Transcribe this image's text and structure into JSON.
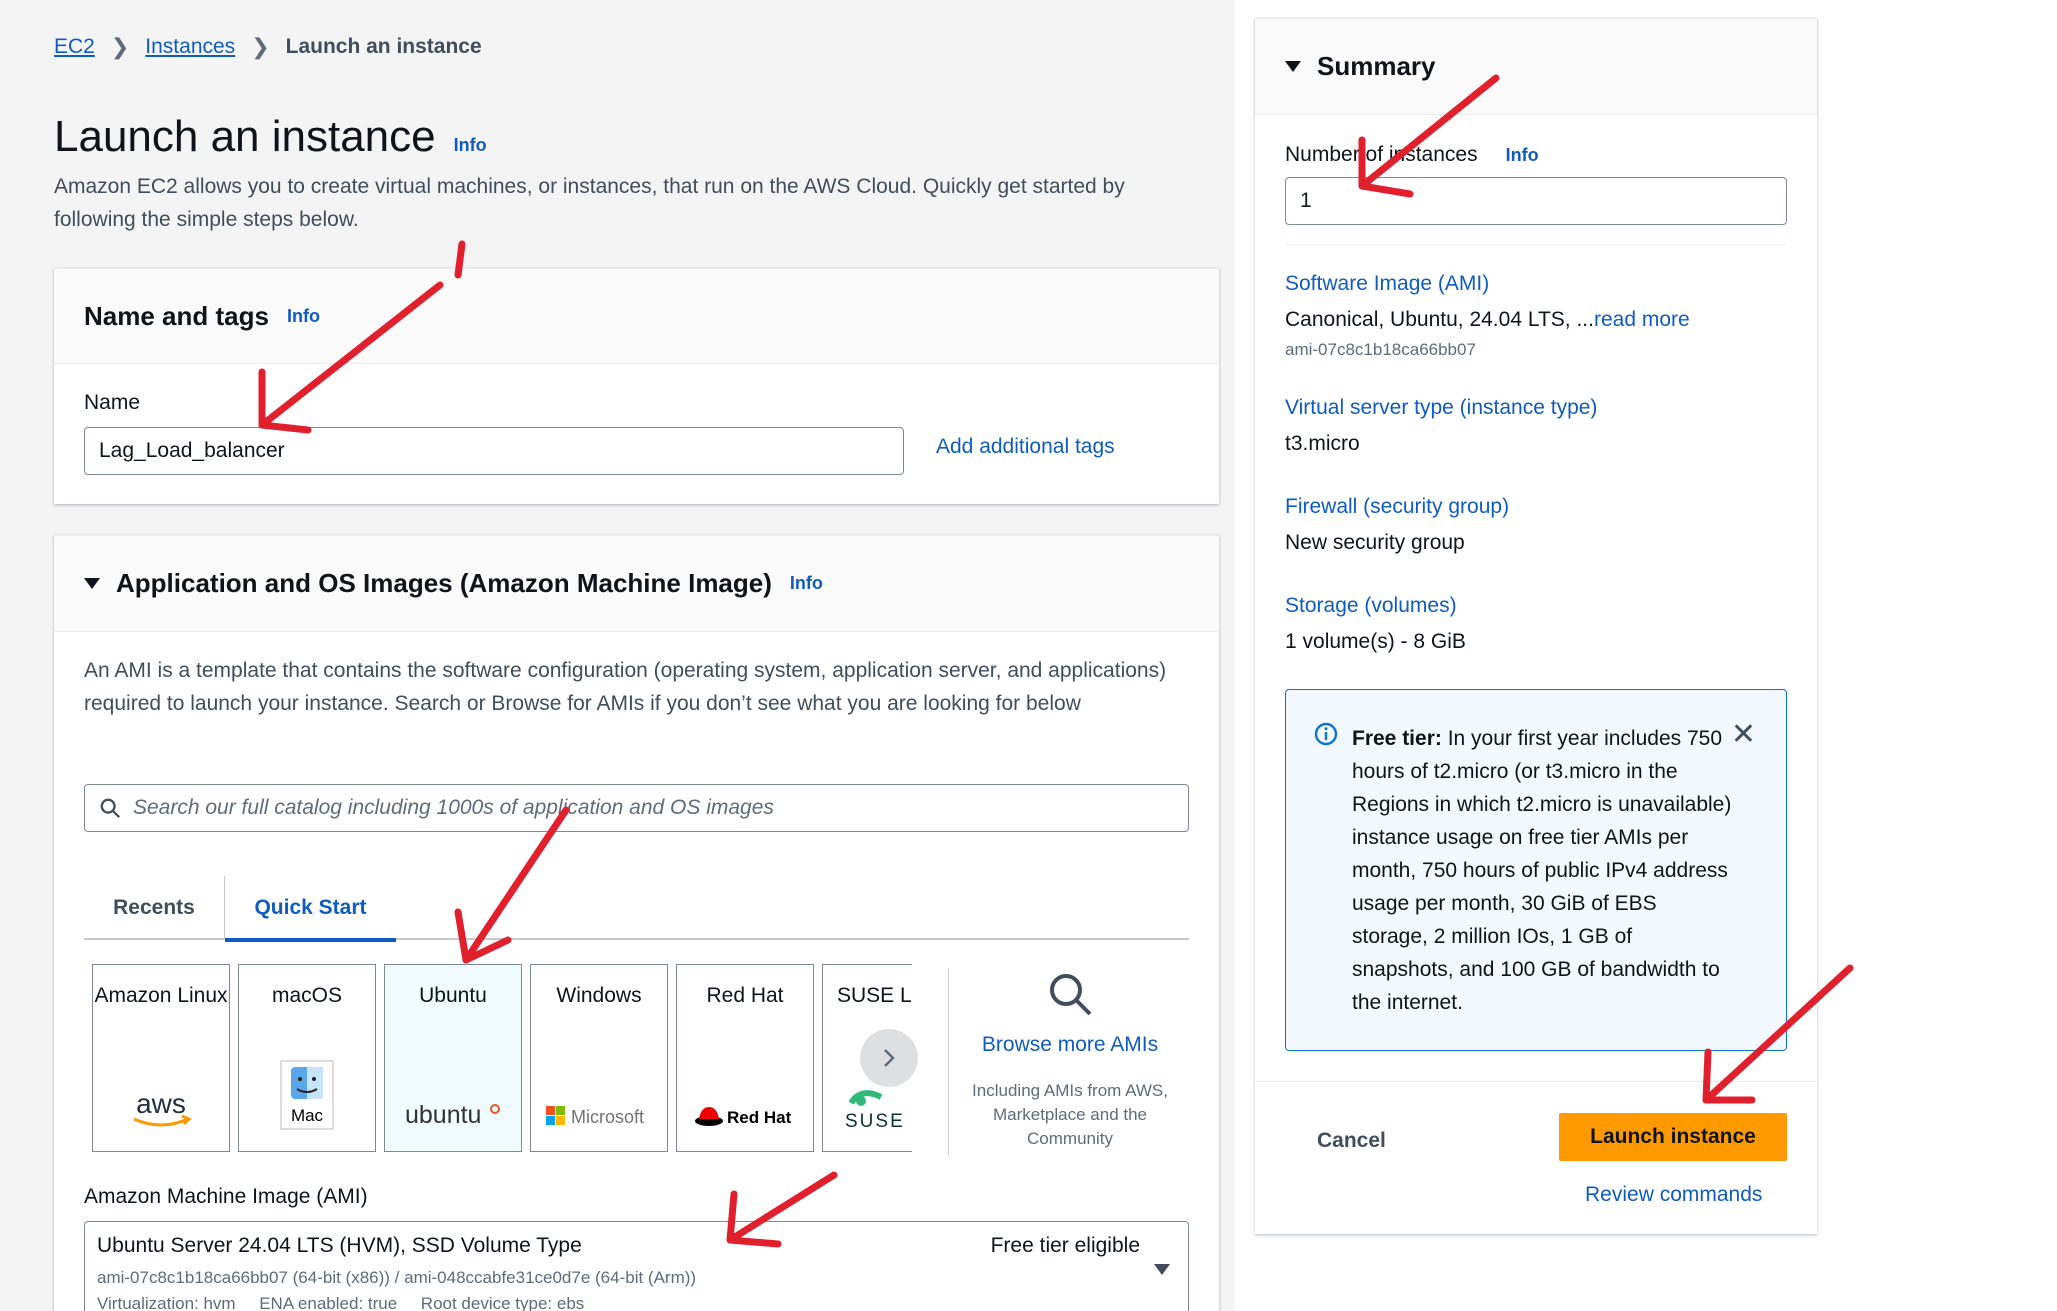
{
  "breadcrumb": {
    "ec2": "EC2",
    "instances": "Instances",
    "current": "Launch an instance"
  },
  "page": {
    "title": "Launch an instance",
    "info": "Info",
    "description": "Amazon EC2 allows you to create virtual machines, or instances, that run on the AWS Cloud. Quickly get started by following the simple steps below."
  },
  "name_tags": {
    "title": "Name and tags",
    "info": "Info",
    "name_label": "Name",
    "name_value": "Lag_Load_balancer",
    "add_tags": "Add additional tags"
  },
  "ami_section": {
    "title": "Application and OS Images (Amazon Machine Image)",
    "info": "Info",
    "description": "An AMI is a template that contains the software configuration (operating system, application server, and applications) required to launch your instance. Search or Browse for AMIs if you don’t see what you are looking for below",
    "search_placeholder": "Search our full catalog including 1000s of application and OS images",
    "tabs": [
      "Recents",
      "Quick Start"
    ],
    "active_tab": "Quick Start",
    "tiles": [
      {
        "label": "Amazon Linux",
        "logo_text": "aws"
      },
      {
        "label": "macOS",
        "logo_text": "Mac"
      },
      {
        "label": "Ubuntu",
        "logo_text": "ubuntu",
        "selected": true
      },
      {
        "label": "Windows",
        "logo_text": "Microsoft"
      },
      {
        "label": "Red Hat",
        "logo_text": "Red Hat"
      },
      {
        "label": "SUSE Li",
        "logo_text": "SUSE"
      }
    ],
    "browse_link": "Browse more AMIs",
    "browse_sub": "Including AMIs from AWS, Marketplace and the Community",
    "ami_label": "Amazon Machine Image (AMI)",
    "ami_name": "Ubuntu Server 24.04 LTS (HVM), SSD Volume Type",
    "ami_free": "Free tier eligible",
    "ami_ids": "ami-07c8c1b18ca66bb07 (64-bit (x86)) / ami-048ccabfe31ce0d7e (64-bit (Arm))",
    "ami_meta": "Virtualization: hvm     ENA enabled: true     Root device type: ebs"
  },
  "summary": {
    "title": "Summary",
    "num_label": "Number of instances",
    "info": "Info",
    "num_value": "1",
    "software_key": "Software Image (AMI)",
    "software_val": "Canonical, Ubuntu, 24.04 LTS, ...",
    "read_more": "read more",
    "software_id": "ami-07c8c1b18ca66bb07",
    "server_key": "Virtual server type (instance type)",
    "server_val": "t3.micro",
    "firewall_key": "Firewall (security group)",
    "firewall_val": "New security group",
    "storage_key": "Storage (volumes)",
    "storage_val": "1 volume(s) - 8 GiB",
    "alert_bold": "Free tier:",
    "alert_text": " In your first year includes 750 hours of t2.micro (or t3.micro in the Regions in which t2.micro is unavailable) instance usage on free tier AMIs per month, 750 hours of public IPv4 address usage per month, 30 GiB of EBS storage, 2 million IOs, 1 GB of snapshots, and 100 GB of bandwidth to the internet.",
    "cancel": "Cancel",
    "launch": "Launch instance",
    "review": "Review commands"
  },
  "colors": {
    "link": "#0f5cc0",
    "primary_button": "#ff9900",
    "annotation_arrow": "#e0202c",
    "alert_border": "#0972d3"
  }
}
